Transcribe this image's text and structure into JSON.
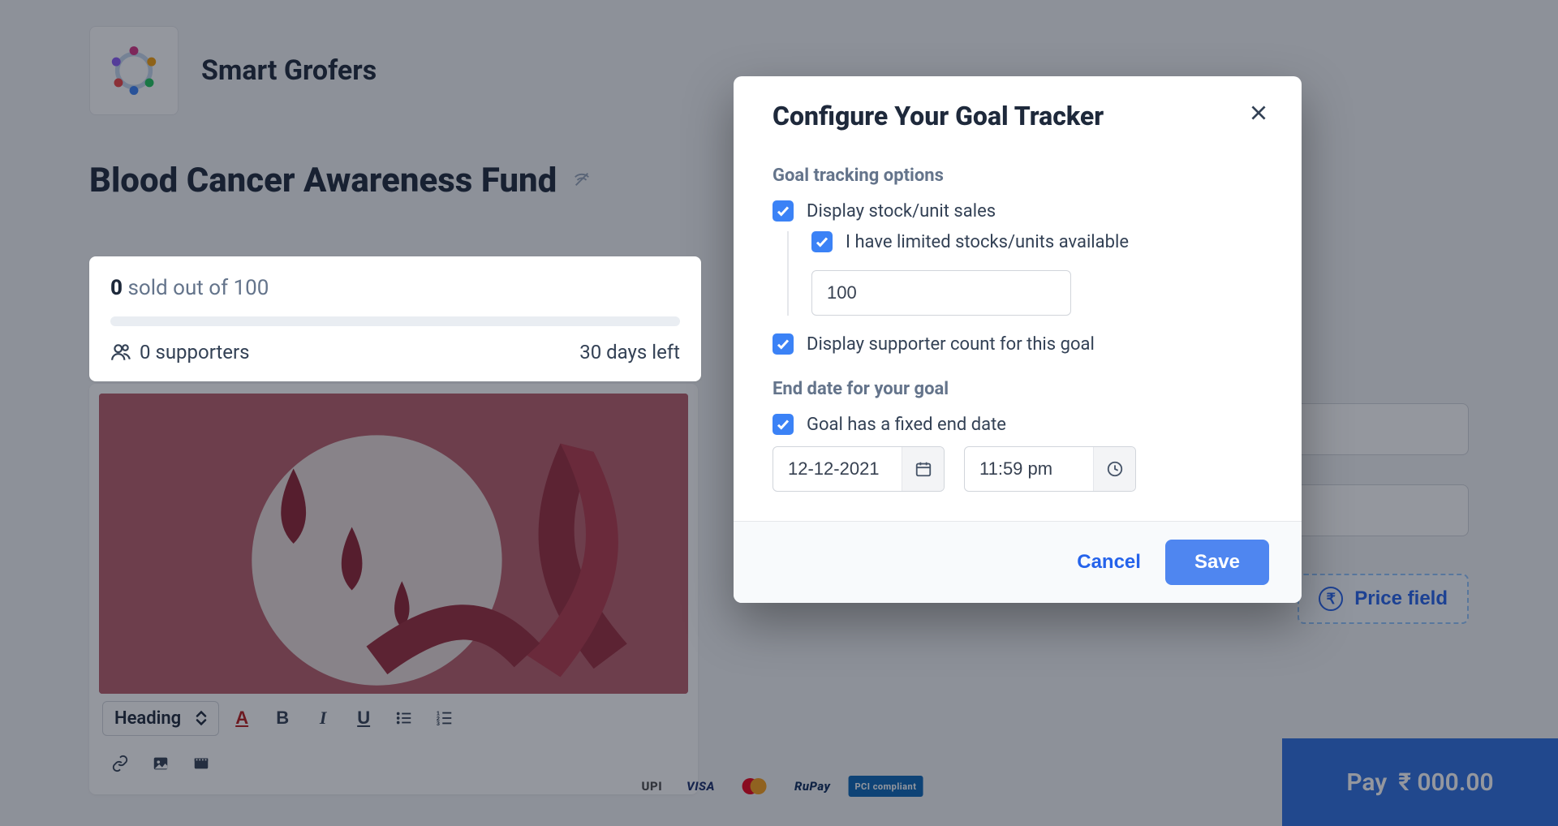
{
  "brand": {
    "name": "Smart Grofers"
  },
  "page_title": "Blood Cancer Awareness Fund",
  "goal": {
    "sold_count": "0",
    "sold_label": " sold out of 100",
    "supporters": "0 supporters",
    "days_left": "30 days left"
  },
  "editor": {
    "heading_select": "Heading"
  },
  "modal": {
    "title": "Configure Your Goal Tracker",
    "section_tracking": "Goal tracking options",
    "chk_stock": "Display stock/unit sales",
    "chk_limited": "I have limited stocks/units available",
    "stock_value": "100",
    "chk_supporters": "Display supporter count for this goal",
    "section_end": "End date for your goal",
    "chk_enddate": "Goal has a fixed end date",
    "date": "12-12-2021",
    "time": "11:59 pm",
    "cancel": "Cancel",
    "save": "Save"
  },
  "right": {
    "price_field": "Price field"
  },
  "pay": {
    "label": "Pay",
    "amount": "₹ 000.00"
  },
  "payment_logos": {
    "upi": "UPI",
    "visa": "VISA",
    "rupay": "RuPay",
    "pci": "PCI compliant"
  }
}
